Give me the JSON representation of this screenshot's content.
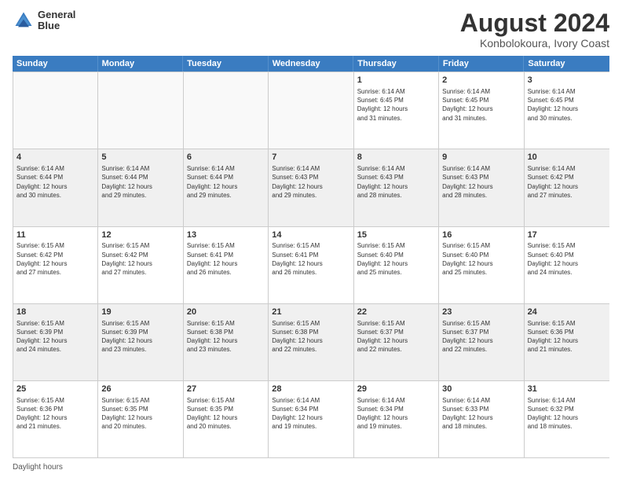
{
  "header": {
    "logo_line1": "General",
    "logo_line2": "Blue",
    "main_title": "August 2024",
    "subtitle": "Konbolokoura, Ivory Coast"
  },
  "calendar": {
    "days_of_week": [
      "Sunday",
      "Monday",
      "Tuesday",
      "Wednesday",
      "Thursday",
      "Friday",
      "Saturday"
    ],
    "weeks": [
      {
        "cells": [
          {
            "day": "",
            "empty": true
          },
          {
            "day": "",
            "empty": true
          },
          {
            "day": "",
            "empty": true
          },
          {
            "day": "",
            "empty": true
          },
          {
            "day": "1",
            "line1": "Sunrise: 6:14 AM",
            "line2": "Sunset: 6:45 PM",
            "line3": "Daylight: 12 hours",
            "line4": "and 31 minutes."
          },
          {
            "day": "2",
            "line1": "Sunrise: 6:14 AM",
            "line2": "Sunset: 6:45 PM",
            "line3": "Daylight: 12 hours",
            "line4": "and 31 minutes."
          },
          {
            "day": "3",
            "line1": "Sunrise: 6:14 AM",
            "line2": "Sunset: 6:45 PM",
            "line3": "Daylight: 12 hours",
            "line4": "and 30 minutes."
          }
        ]
      },
      {
        "cells": [
          {
            "day": "4",
            "line1": "Sunrise: 6:14 AM",
            "line2": "Sunset: 6:44 PM",
            "line3": "Daylight: 12 hours",
            "line4": "and 30 minutes."
          },
          {
            "day": "5",
            "line1": "Sunrise: 6:14 AM",
            "line2": "Sunset: 6:44 PM",
            "line3": "Daylight: 12 hours",
            "line4": "and 29 minutes."
          },
          {
            "day": "6",
            "line1": "Sunrise: 6:14 AM",
            "line2": "Sunset: 6:44 PM",
            "line3": "Daylight: 12 hours",
            "line4": "and 29 minutes."
          },
          {
            "day": "7",
            "line1": "Sunrise: 6:14 AM",
            "line2": "Sunset: 6:43 PM",
            "line3": "Daylight: 12 hours",
            "line4": "and 29 minutes."
          },
          {
            "day": "8",
            "line1": "Sunrise: 6:14 AM",
            "line2": "Sunset: 6:43 PM",
            "line3": "Daylight: 12 hours",
            "line4": "and 28 minutes."
          },
          {
            "day": "9",
            "line1": "Sunrise: 6:14 AM",
            "line2": "Sunset: 6:43 PM",
            "line3": "Daylight: 12 hours",
            "line4": "and 28 minutes."
          },
          {
            "day": "10",
            "line1": "Sunrise: 6:14 AM",
            "line2": "Sunset: 6:42 PM",
            "line3": "Daylight: 12 hours",
            "line4": "and 27 minutes."
          }
        ]
      },
      {
        "cells": [
          {
            "day": "11",
            "line1": "Sunrise: 6:15 AM",
            "line2": "Sunset: 6:42 PM",
            "line3": "Daylight: 12 hours",
            "line4": "and 27 minutes."
          },
          {
            "day": "12",
            "line1": "Sunrise: 6:15 AM",
            "line2": "Sunset: 6:42 PM",
            "line3": "Daylight: 12 hours",
            "line4": "and 27 minutes."
          },
          {
            "day": "13",
            "line1": "Sunrise: 6:15 AM",
            "line2": "Sunset: 6:41 PM",
            "line3": "Daylight: 12 hours",
            "line4": "and 26 minutes."
          },
          {
            "day": "14",
            "line1": "Sunrise: 6:15 AM",
            "line2": "Sunset: 6:41 PM",
            "line3": "Daylight: 12 hours",
            "line4": "and 26 minutes."
          },
          {
            "day": "15",
            "line1": "Sunrise: 6:15 AM",
            "line2": "Sunset: 6:40 PM",
            "line3": "Daylight: 12 hours",
            "line4": "and 25 minutes."
          },
          {
            "day": "16",
            "line1": "Sunrise: 6:15 AM",
            "line2": "Sunset: 6:40 PM",
            "line3": "Daylight: 12 hours",
            "line4": "and 25 minutes."
          },
          {
            "day": "17",
            "line1": "Sunrise: 6:15 AM",
            "line2": "Sunset: 6:40 PM",
            "line3": "Daylight: 12 hours",
            "line4": "and 24 minutes."
          }
        ]
      },
      {
        "cells": [
          {
            "day": "18",
            "line1": "Sunrise: 6:15 AM",
            "line2": "Sunset: 6:39 PM",
            "line3": "Daylight: 12 hours",
            "line4": "and 24 minutes."
          },
          {
            "day": "19",
            "line1": "Sunrise: 6:15 AM",
            "line2": "Sunset: 6:39 PM",
            "line3": "Daylight: 12 hours",
            "line4": "and 23 minutes."
          },
          {
            "day": "20",
            "line1": "Sunrise: 6:15 AM",
            "line2": "Sunset: 6:38 PM",
            "line3": "Daylight: 12 hours",
            "line4": "and 23 minutes."
          },
          {
            "day": "21",
            "line1": "Sunrise: 6:15 AM",
            "line2": "Sunset: 6:38 PM",
            "line3": "Daylight: 12 hours",
            "line4": "and 22 minutes."
          },
          {
            "day": "22",
            "line1": "Sunrise: 6:15 AM",
            "line2": "Sunset: 6:37 PM",
            "line3": "Daylight: 12 hours",
            "line4": "and 22 minutes."
          },
          {
            "day": "23",
            "line1": "Sunrise: 6:15 AM",
            "line2": "Sunset: 6:37 PM",
            "line3": "Daylight: 12 hours",
            "line4": "and 22 minutes."
          },
          {
            "day": "24",
            "line1": "Sunrise: 6:15 AM",
            "line2": "Sunset: 6:36 PM",
            "line3": "Daylight: 12 hours",
            "line4": "and 21 minutes."
          }
        ]
      },
      {
        "cells": [
          {
            "day": "25",
            "line1": "Sunrise: 6:15 AM",
            "line2": "Sunset: 6:36 PM",
            "line3": "Daylight: 12 hours",
            "line4": "and 21 minutes."
          },
          {
            "day": "26",
            "line1": "Sunrise: 6:15 AM",
            "line2": "Sunset: 6:35 PM",
            "line3": "Daylight: 12 hours",
            "line4": "and 20 minutes."
          },
          {
            "day": "27",
            "line1": "Sunrise: 6:15 AM",
            "line2": "Sunset: 6:35 PM",
            "line3": "Daylight: 12 hours",
            "line4": "and 20 minutes."
          },
          {
            "day": "28",
            "line1": "Sunrise: 6:14 AM",
            "line2": "Sunset: 6:34 PM",
            "line3": "Daylight: 12 hours",
            "line4": "and 19 minutes."
          },
          {
            "day": "29",
            "line1": "Sunrise: 6:14 AM",
            "line2": "Sunset: 6:34 PM",
            "line3": "Daylight: 12 hours",
            "line4": "and 19 minutes."
          },
          {
            "day": "30",
            "line1": "Sunrise: 6:14 AM",
            "line2": "Sunset: 6:33 PM",
            "line3": "Daylight: 12 hours",
            "line4": "and 18 minutes."
          },
          {
            "day": "31",
            "line1": "Sunrise: 6:14 AM",
            "line2": "Sunset: 6:32 PM",
            "line3": "Daylight: 12 hours",
            "line4": "and 18 minutes."
          }
        ]
      }
    ]
  },
  "footer": {
    "text": "Daylight hours"
  }
}
